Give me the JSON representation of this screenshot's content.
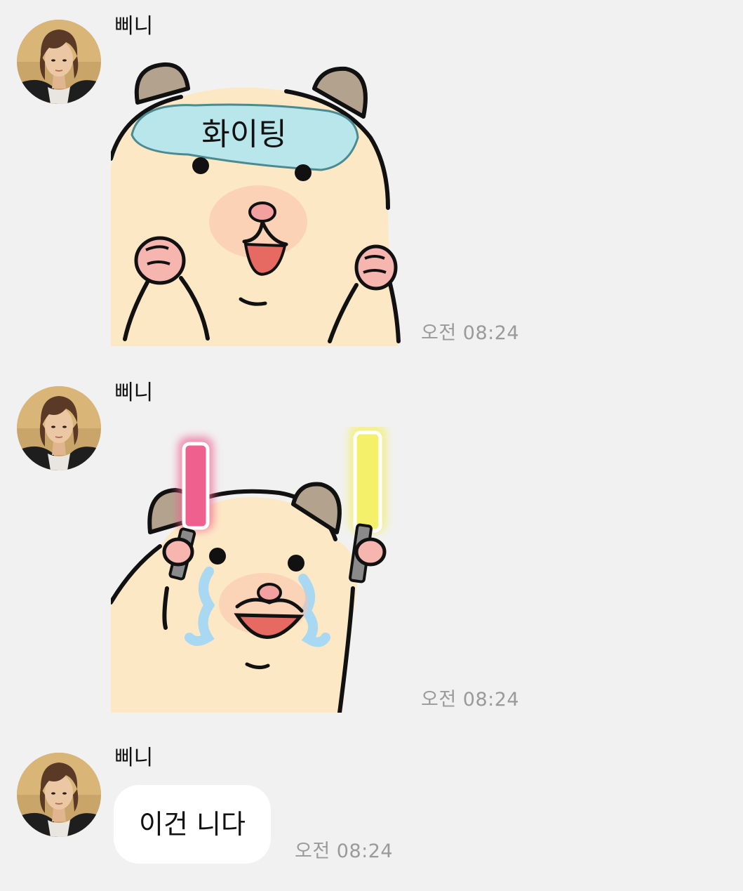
{
  "chat": {
    "messages": [
      {
        "sender": "삐니",
        "type": "sticker",
        "sticker_icon": "hamster-headband-sticker-icon",
        "sticker_text": "화이팅",
        "time": "오전 08:24"
      },
      {
        "sender": "삐니",
        "type": "sticker",
        "sticker_icon": "hamster-glowsticks-crying-sticker-icon",
        "time": "오전 08:24"
      },
      {
        "sender": "삐니",
        "type": "text",
        "text": "이건 니다",
        "time": "오전 08:24"
      }
    ]
  },
  "colors": {
    "background": "#f1f1f1",
    "bubble": "#ffffff",
    "timestamp": "#9a9a9a",
    "hamster_fur": "#fde8c6",
    "headband": "#b8e6ea",
    "pink_glowstick": "#f0608f",
    "yellow_glowstick": "#f4f06a",
    "tears": "#a8d8f2"
  }
}
